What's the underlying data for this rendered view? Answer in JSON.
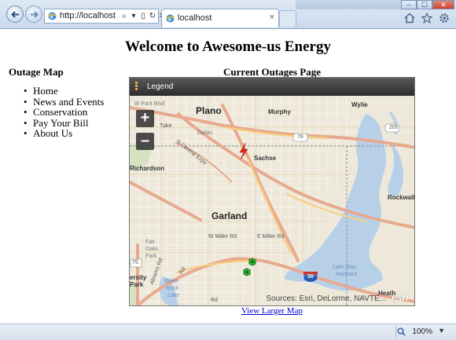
{
  "browser": {
    "address": "http://localhost",
    "tab_title": "localhost",
    "tab_close": "×",
    "addr_tools": [
      "⌕",
      "▾",
      "▯",
      "↻",
      "✕"
    ],
    "window_buttons": [
      "–",
      "☐",
      "✕"
    ],
    "zoom_level": "100%",
    "zoom_dropdown": "▼"
  },
  "page": {
    "title": "Welcome to Awesome-us Energy",
    "sidebar_title": "Outage Map",
    "nav_items": [
      "Home",
      "News and Events",
      "Conservation",
      "Pay Your Bill",
      "About Us"
    ],
    "map_heading": "Current Outages Page",
    "view_larger": "View Larger Map"
  },
  "map": {
    "legend_label": "Legend",
    "zoom_in": "+",
    "zoom_out": "–",
    "attribution": "Sources: Esri, DeLorme, NAVTE...",
    "logo": "esri",
    "labels": {
      "plano": "Plano",
      "garland": "Garland",
      "murphy": "Murphy",
      "wylie": "Wylie",
      "sachse": "Sachse",
      "richardson": "Richardson",
      "rockwall": "Rockwall",
      "heath": "Heath",
      "dallas": "Dallas",
      "w_park_blvd": "W Park Blvd",
      "tpke": "Tpke",
      "n_central_expy": "N Central Expy",
      "w_miller_rd": "W Miller Rd",
      "e_miller_rd": "E Miller Rd",
      "fair_oaks_park": [
        "Fair",
        "Oaks",
        "Park"
      ],
      "lake_ray_hubbard": [
        "Lake Ray",
        "Hubbard"
      ],
      "white_rock_lake": [
        "White",
        "Rock",
        "Lake"
      ],
      "abrams_rd": "Abrams Rd",
      "ersity_park": [
        "ersity",
        "Park"
      ],
      "shield_78": "78",
      "shield_205": "205",
      "shield_75": "75",
      "shield_30": "30",
      "rd_label": "Rd",
      "rd_bottom": "Rd"
    },
    "markers": {
      "outage": "lightning-bolt",
      "crew": "green-hexagon"
    }
  }
}
